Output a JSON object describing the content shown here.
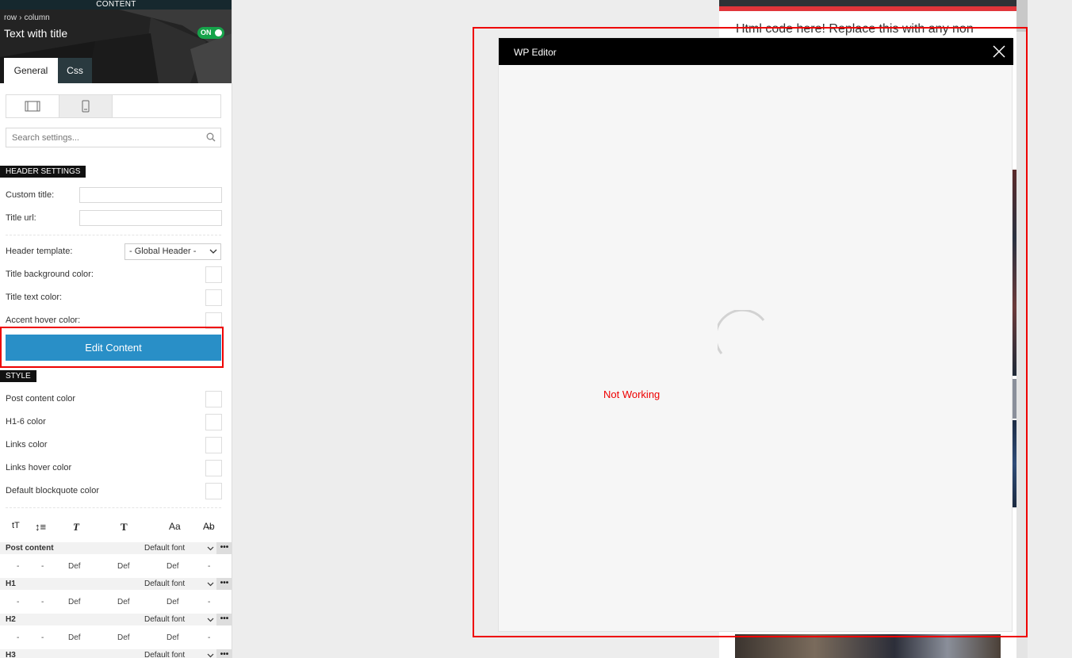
{
  "panel": {
    "top_label": "CONTENT",
    "breadcrumb": [
      "row",
      "column"
    ],
    "breadcrumb_sep": "›",
    "element_title": "Text with title",
    "toggle_label": "ON",
    "tabs": [
      {
        "label": "General"
      },
      {
        "label": "Css"
      }
    ],
    "search_placeholder": "Search settings...",
    "header_settings": {
      "section": "HEADER SETTINGS",
      "custom_title": "Custom title:",
      "title_url": "Title url:",
      "header_template": "Header template:",
      "header_template_value": "- Global Header -",
      "title_bg_color": "Title background color:",
      "title_text_color": "Title text color:",
      "accent_hover_color": "Accent hover color:"
    },
    "edit_content": "Edit Content",
    "style": {
      "section": "STYLE",
      "items": [
        "Post content color",
        "H1-6 color",
        "Links color",
        "Links hover color",
        "Default blockquote color"
      ]
    },
    "typography": {
      "icons": [
        "tT",
        "↕≡",
        "T",
        "T",
        "Aa",
        "A̶b"
      ],
      "rows": [
        {
          "name": "Post content",
          "font": "Default font"
        },
        {
          "name": "H1",
          "font": "Default font"
        },
        {
          "name": "H2",
          "font": "Default font"
        },
        {
          "name": "H3",
          "font": "Default font"
        }
      ],
      "sub": {
        "dash": "-",
        "def": "Def"
      },
      "more": "•••"
    }
  },
  "preview": {
    "html_text": "Html code here! Replace this with any non"
  },
  "modal": {
    "title": "WP Editor",
    "annotation": "Not Working"
  }
}
